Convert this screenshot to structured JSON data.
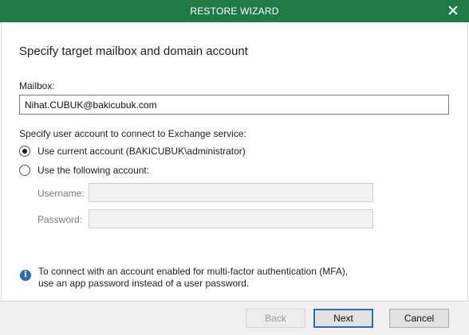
{
  "window": {
    "title": "RESTORE WIZARD",
    "close_icon": "close-icon"
  },
  "page": {
    "heading": "Specify target mailbox and domain account"
  },
  "mailbox": {
    "label": "Mailbox:",
    "value": "Nihat.CUBUK@bakicubuk.com"
  },
  "account": {
    "prompt": "Specify user account to connect to Exchange service:",
    "option_current": "Use current account (BAKICUBUK\\administrator)",
    "option_following": "Use the following account:",
    "selected": "current",
    "username_label": "Username:",
    "username_value": "",
    "password_label": "Password:",
    "password_value": ""
  },
  "info": {
    "icon": "info-icon",
    "line1": "To connect with an account enabled for multi-factor authentication (MFA),",
    "line2": "use an app password instead of a user password."
  },
  "buttons": {
    "back": "Back",
    "next": "Next",
    "cancel": "Cancel"
  },
  "colors": {
    "titlebar": "#1f7b46",
    "info_icon": "#2b6cb3",
    "primary_border": "#2d6db5"
  }
}
